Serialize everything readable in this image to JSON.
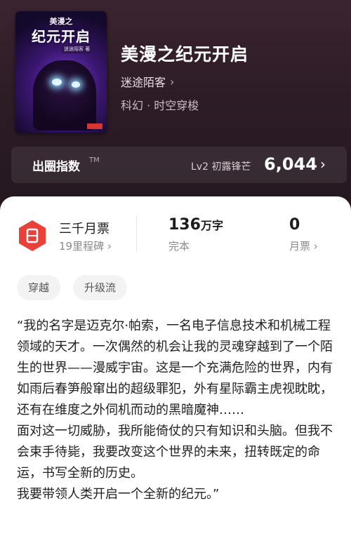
{
  "book": {
    "cover": {
      "small_text": "美漫之",
      "title_text": "纪元开启",
      "tag_text": "迷途陌客 著"
    },
    "title": "美漫之纪元开启",
    "author": "迷途陌客",
    "genre": "科幻 · 时空穿梭"
  },
  "rating": {
    "label": "出圈指数",
    "tm": "TM",
    "level": "Lv2 初露锋芒",
    "score": "6,044"
  },
  "stats": {
    "tickets": {
      "main": "三千月票",
      "sub": "19里程碑",
      "icon": "ticket-icon",
      "icon_color": "#e8413a"
    },
    "words": {
      "number": "136",
      "unit": "万字",
      "sub": "完本"
    },
    "monthly": {
      "number": "0",
      "sub": "月票"
    }
  },
  "tags": [
    "穿越",
    "升级流"
  ],
  "description": "“我的名字是迈克尔·帕索，一名电子信息技术和机械工程领域的天才。一次偶然的机会让我的灵魂穿越到了一个陌生的世界——漫威宇宙。这是一个充满危险的世界，内有如雨后春笋般窜出的超级罪犯，外有星际霸主虎视眈眈，还有在维度之外伺机而动的黑暗魔神……\n面对这一切威胁，我所能倚仗的只有知识和头脑。但我不会束手待毙，我要改变这个世界的未来，扭转既定的命运，书写全新的历史。\n我要带领人类开启一个全新的纪元。”",
  "colors": {
    "accent_red": "#e8413a",
    "hero_bg": "#2d1c26"
  }
}
